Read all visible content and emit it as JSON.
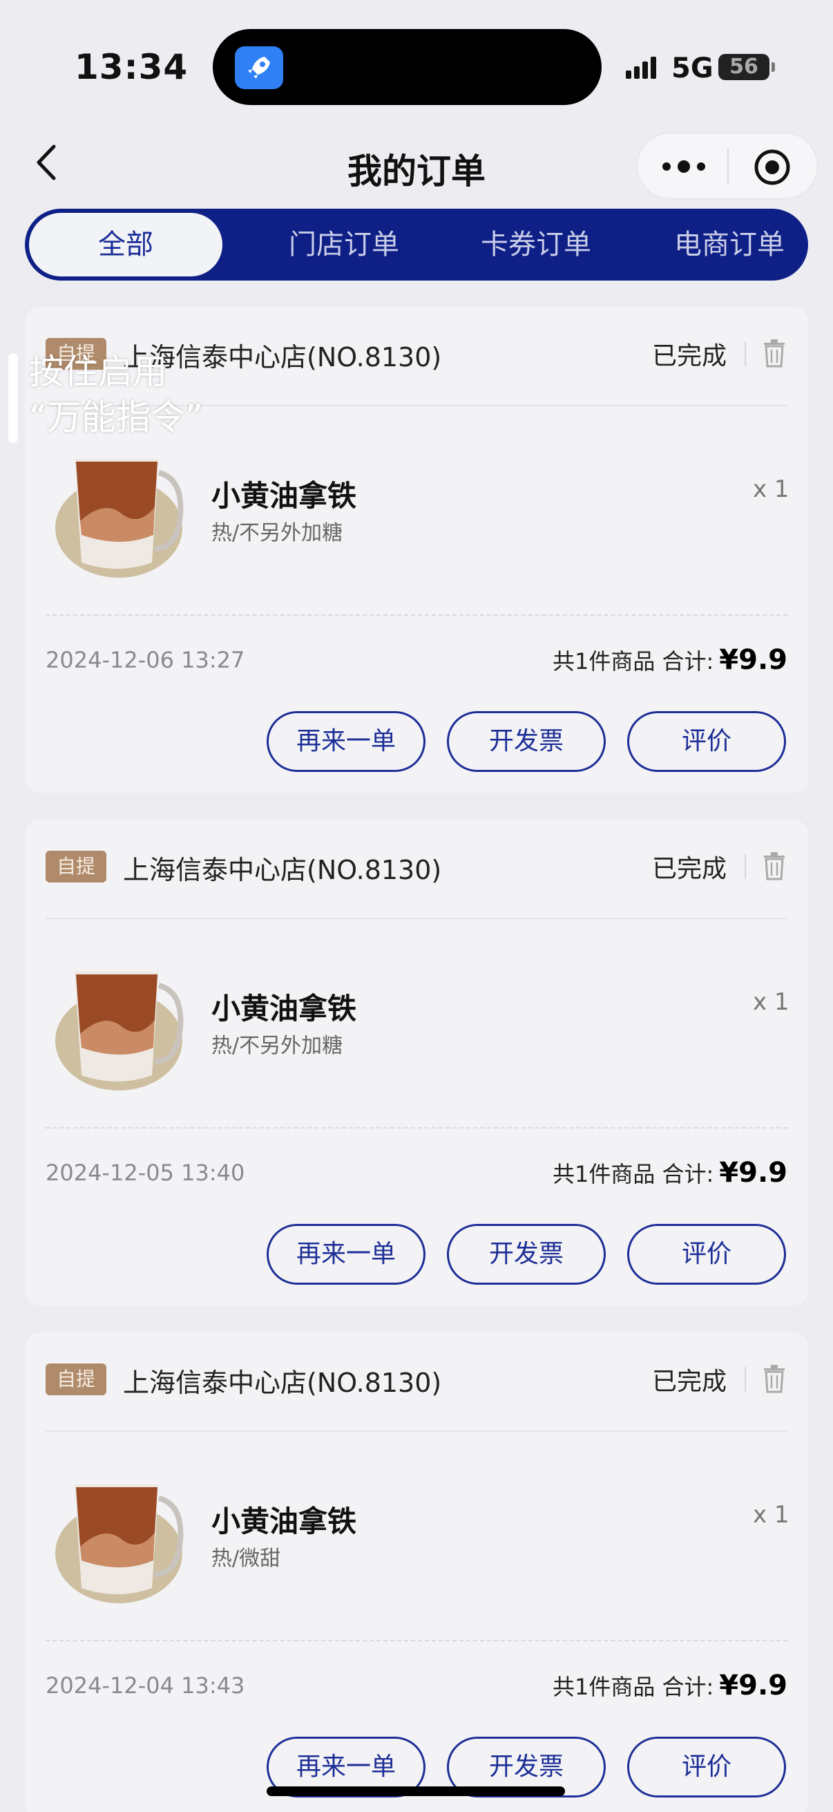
{
  "status_bar": {
    "time": "13:34",
    "network": "5G",
    "battery": "56"
  },
  "nav": {
    "title": "我的订单"
  },
  "tabs": [
    {
      "label": "全部",
      "active": true
    },
    {
      "label": "门店订单",
      "active": false
    },
    {
      "label": "卡券订单",
      "active": false
    },
    {
      "label": "电商订单",
      "active": false
    }
  ],
  "overlay_hint": {
    "line1": "按住启用",
    "line2": "“万能指令”"
  },
  "orders": [
    {
      "type_badge": "自提",
      "store": "上海信泰中心店(NO.8130)",
      "status": "已完成",
      "product_name": "小黄油拿铁",
      "product_spec": "热/不另外加糖",
      "quantity": "x 1",
      "datetime": "2024-12-06 13:27",
      "summary_label": "共1件商品 合计:",
      "total": "¥9.9",
      "buttons": [
        "再来一单",
        "开发票",
        "评价"
      ]
    },
    {
      "type_badge": "自提",
      "store": "上海信泰中心店(NO.8130)",
      "status": "已完成",
      "product_name": "小黄油拿铁",
      "product_spec": "热/不另外加糖",
      "quantity": "x 1",
      "datetime": "2024-12-05 13:40",
      "summary_label": "共1件商品 合计:",
      "total": "¥9.9",
      "buttons": [
        "再来一单",
        "开发票",
        "评价"
      ]
    },
    {
      "type_badge": "自提",
      "store": "上海信泰中心店(NO.8130)",
      "status": "已完成",
      "product_name": "小黄油拿铁",
      "product_spec": "热/微甜",
      "quantity": "x 1",
      "datetime": "2024-12-04 13:43",
      "summary_label": "共1件商品 合计:",
      "total": "¥9.9",
      "buttons": [
        "再来一单",
        "开发票",
        "评价"
      ]
    }
  ],
  "colors": {
    "brand_navy": "#0e1f86",
    "button_outline": "#1d2e96",
    "badge_brown": "#b08b6b",
    "page_bg": "#ededf1"
  },
  "icons": [
    "back-arrow-icon",
    "more-dots-icon",
    "record-target-icon",
    "trash-icon",
    "rocket-app-icon",
    "signal-icon",
    "battery-icon"
  ]
}
